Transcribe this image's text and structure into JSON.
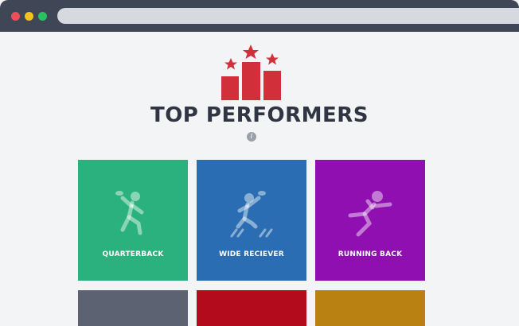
{
  "page": {
    "title": "TOP PERFORMERS",
    "info_glyph": "i"
  },
  "tiles": [
    {
      "label": "QUARTERBACK",
      "icon": "quarterback-icon",
      "color": "#2bb17d"
    },
    {
      "label": "WIDE RECIEVER",
      "icon": "wide-receiver-icon",
      "color": "#2a6db3"
    },
    {
      "label": "RUNNING BACK",
      "icon": "running-back-icon",
      "color": "#8f0fb0"
    },
    {
      "label": "",
      "icon": "player-icon",
      "color": "#5c6272"
    },
    {
      "label": "",
      "icon": "player-icon",
      "color": "#b40b1c"
    },
    {
      "label": "",
      "icon": "player-icon",
      "color": "#b98112"
    }
  ],
  "colors": {
    "accent": "#d1303b",
    "title": "#2f3542",
    "chrome": "#3f4756"
  }
}
